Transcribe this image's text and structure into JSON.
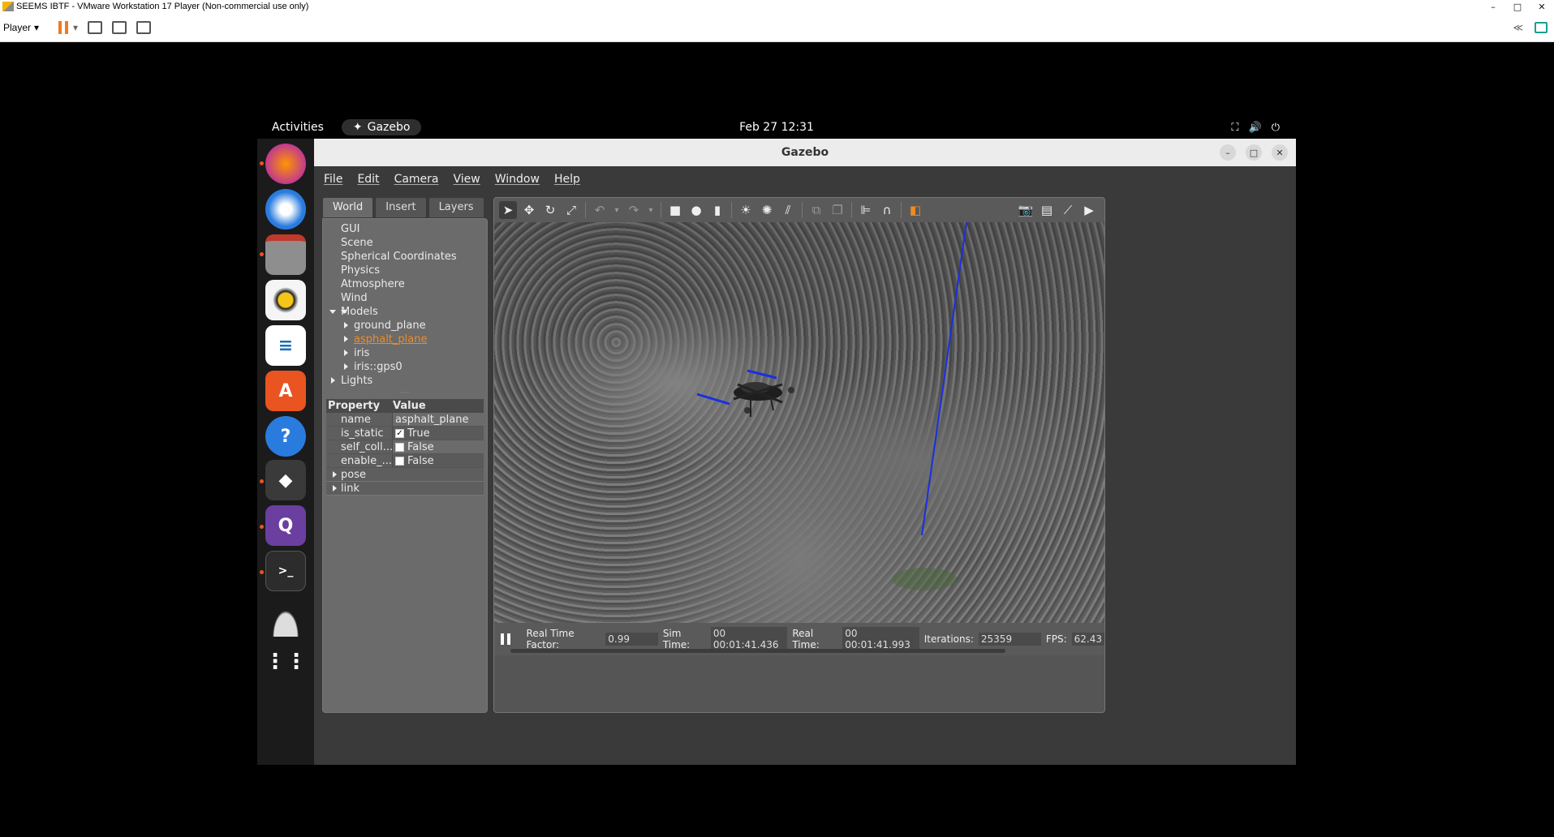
{
  "vmware": {
    "title": "SEEMS IBTF - VMware Workstation 17 Player (Non-commercial use only)",
    "player_menu": "Player",
    "window_controls": [
      "–",
      "□",
      "✕"
    ]
  },
  "topbar": {
    "activities": "Activities",
    "app": "Gazebo",
    "clock": "Feb 27  12:31"
  },
  "dock": {
    "apps": [
      "firefox",
      "thunderbird",
      "files",
      "rhythmbox",
      "writer",
      "app-center",
      "help",
      "gazebo",
      "qgroundcontrol",
      "terminal",
      "disk",
      "show-apps"
    ]
  },
  "gazebo": {
    "window_title": "Gazebo",
    "menu": [
      "File",
      "Edit",
      "Camera",
      "View",
      "Window",
      "Help"
    ],
    "tabs": [
      "World",
      "Insert",
      "Layers"
    ],
    "tree": {
      "gui": "GUI",
      "scene": "Scene",
      "spherical": "Spherical Coordinates",
      "physics": "Physics",
      "atmosphere": "Atmosphere",
      "wind": "Wind",
      "models": "Models",
      "model_items": [
        "ground_plane",
        "asphalt_plane",
        "iris",
        "iris::gps0"
      ],
      "lights": "Lights"
    },
    "props": {
      "header_property": "Property",
      "header_value": "Value",
      "rows": [
        {
          "key": "name",
          "value": "asphalt_plane"
        },
        {
          "key": "is_static",
          "value": "True"
        },
        {
          "key": "self_coll...",
          "value": "False"
        },
        {
          "key": "enable_...",
          "value": "False"
        }
      ],
      "groups": [
        "pose",
        "link"
      ]
    },
    "status": {
      "rtf_label": "Real Time Factor:",
      "rtf": "0.99",
      "sim_label": "Sim Time:",
      "sim": "00 00:01:41.436",
      "real_label": "Real Time:",
      "real": "00 00:01:41.993",
      "iter_label": "Iterations:",
      "iter": "25359",
      "fps_label": "FPS:",
      "fps": "62.43"
    }
  }
}
